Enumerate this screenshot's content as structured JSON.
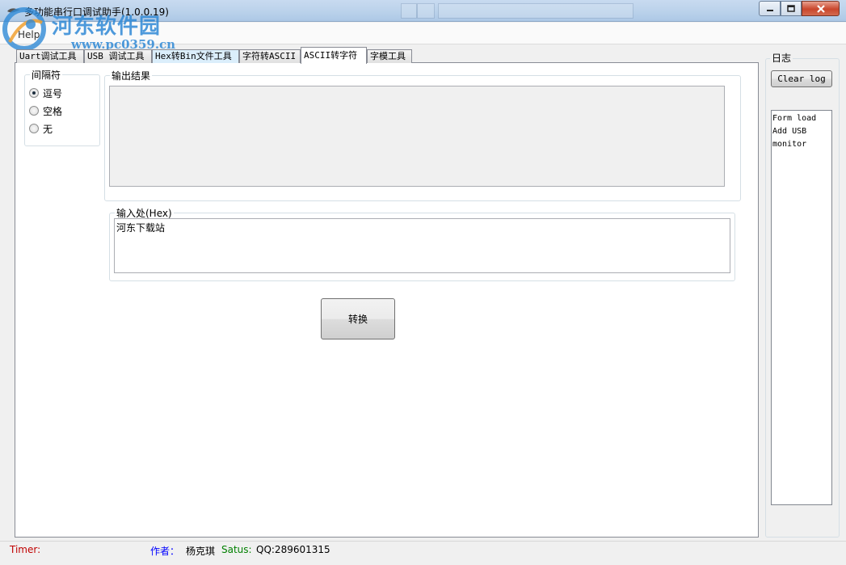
{
  "window": {
    "title": "多功能串行口调试助手(1.0.0.19)",
    "controls": [
      "minimize-icon",
      "maximize-icon",
      "close-icon"
    ]
  },
  "watermark": {
    "name": "河东软件园",
    "url": "www.pc0359.cn"
  },
  "menu": {
    "items": [
      "Help"
    ]
  },
  "tabs": [
    {
      "label": "Uart调试工具"
    },
    {
      "label": "USB 调试工具"
    },
    {
      "label": "Hex转Bin文件工具"
    },
    {
      "label": "字符转ASCII"
    },
    {
      "label": "ASCII转字符"
    },
    {
      "label": "字模工具"
    }
  ],
  "active_tab": "ASCII转字符",
  "separator_group": {
    "title": "间隔符",
    "options": [
      {
        "label": "逗号",
        "checked": true
      },
      {
        "label": "空格",
        "checked": false
      },
      {
        "label": "无",
        "checked": false
      }
    ]
  },
  "output_group": {
    "title": "输出结果",
    "value": ""
  },
  "input_group": {
    "title": "输入处(Hex)",
    "value": "河东下载站"
  },
  "convert_button": "转换",
  "log": {
    "title": "日志",
    "clear_button": "Clear log",
    "lines": [
      "Form load",
      "Add USB",
      "monitor"
    ]
  },
  "statusbar": {
    "timer_label": "Timer:",
    "author_label": "作者：",
    "author": "杨克琪",
    "status_label": "Satus:",
    "qq": "QQ:289601315"
  },
  "colors": {
    "timer": "#c00000",
    "author_label": "#0000ff",
    "status_label": "#008000",
    "watermark": "#2f89d6"
  }
}
